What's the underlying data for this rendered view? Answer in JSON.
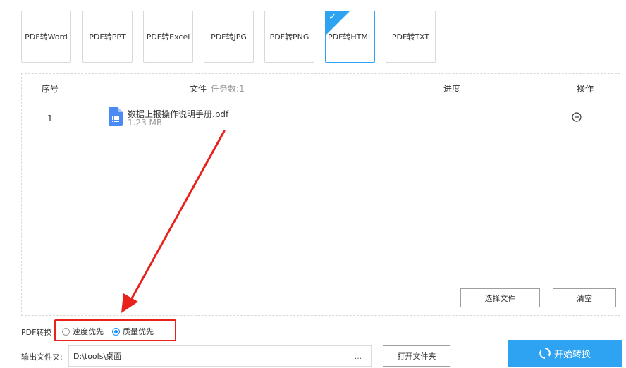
{
  "formats": [
    {
      "label": "PDF转Word",
      "selected": false
    },
    {
      "label": "PDF转PPT",
      "selected": false
    },
    {
      "label": "PDF转Excel",
      "selected": false
    },
    {
      "label": "PDF转JPG",
      "selected": false
    },
    {
      "label": "PDF转PNG",
      "selected": false
    },
    {
      "label": "PDF转HTML",
      "selected": true
    },
    {
      "label": "PDF转TXT",
      "selected": false
    }
  ],
  "table": {
    "col_index": "序号",
    "col_file": "文件",
    "task_count": "任务数:1",
    "col_progress": "进度",
    "col_action": "操作",
    "rows": [
      {
        "index": "1",
        "name": "数据上报操作说明手册.pdf",
        "size": "1.23 MB"
      }
    ]
  },
  "actions": {
    "select_file": "选择文件",
    "clear": "清空"
  },
  "conversion": {
    "label": "PDF转换",
    "options": [
      {
        "label": "速度优先",
        "checked": false
      },
      {
        "label": "质量优先",
        "checked": true
      }
    ]
  },
  "output": {
    "label": "输出文件夹:",
    "path": "D:\\tools\\桌面",
    "browse": "...",
    "open_folder": "打开文件夹"
  },
  "start_label": "开始转换",
  "colors": {
    "accent": "#2ea3f2",
    "annotation": "#e8211d",
    "file_icon": "#4a8af4"
  }
}
